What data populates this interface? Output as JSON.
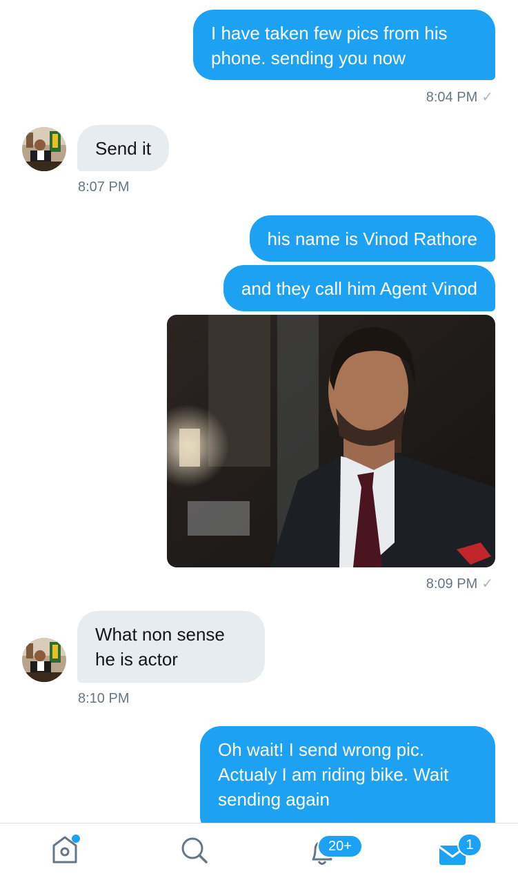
{
  "messages": [
    {
      "direction": "outgoing",
      "lines": [
        "I have taken few pics from his",
        "phone. sending you now"
      ],
      "time": "8:04 PM",
      "read_mark": "✓"
    },
    {
      "direction": "incoming",
      "lines": [
        "Send it"
      ],
      "time": "8:07 PM"
    },
    {
      "direction": "outgoing",
      "lines": [
        "his name is Vinod Rathore"
      ]
    },
    {
      "direction": "outgoing",
      "lines": [
        "and they call him Agent Vinod"
      ]
    },
    {
      "direction": "outgoing",
      "type": "image",
      "time": "8:09 PM",
      "read_mark": "✓"
    },
    {
      "direction": "incoming",
      "lines": [
        "What non sense",
        "he is actor"
      ],
      "time": "8:10 PM"
    },
    {
      "direction": "outgoing",
      "lines": [
        "Oh wait! I send wrong pic.",
        "Actualy I am riding bike. Wait",
        "sending again"
      ]
    }
  ],
  "tabbar": {
    "items": [
      {
        "icon": "home-icon",
        "has_dot": true
      },
      {
        "icon": "search-icon"
      },
      {
        "icon": "bell-icon",
        "badge": "20+"
      },
      {
        "icon": "mail-icon",
        "badge": "1",
        "active": true
      }
    ]
  },
  "colors": {
    "accent": "#1da1f2",
    "incoming_bubble": "#e6ecf0",
    "timestamp": "#657786",
    "icon_gray": "#657786"
  }
}
